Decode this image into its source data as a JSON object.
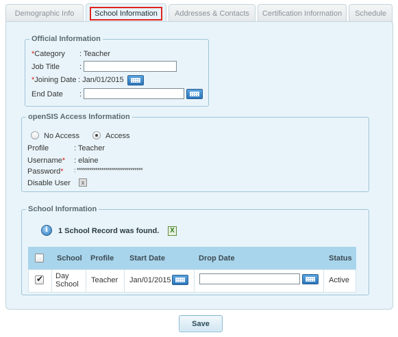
{
  "tabs": [
    {
      "label": "Demographic Info"
    },
    {
      "label": "School Information"
    },
    {
      "label": "Addresses & Contacts"
    },
    {
      "label": "Certification Information"
    },
    {
      "label": "Schedule"
    }
  ],
  "official": {
    "legend": "Official Information",
    "category_label": "Category",
    "category_value": ": Teacher",
    "job_title_label": "Job Title",
    "colon": ":",
    "job_title_value": "",
    "joining_label": "Joining Date",
    "joining_value": ": Jan/01/2015",
    "end_date_label": "End Date",
    "end_date_value": "",
    "required_mark": "*"
  },
  "access": {
    "legend": "openSIS Access Information",
    "no_access_label": "No Access",
    "access_label": "Access",
    "selected": "Access",
    "profile_label": "Profile",
    "profile_value": ": Teacher",
    "username_label": "Username",
    "username_value": ": elaine",
    "password_label": "Password",
    "password_value": ": ********************************",
    "disable_user_label": "Disable User",
    "disable_user_mark": "x",
    "required_mark": "*"
  },
  "school": {
    "legend": "School Information",
    "record_message": "1 School Record was found.",
    "info_icon": "i",
    "excel_icon": "X",
    "columns": [
      "School",
      "Profile",
      "Start Date",
      "Drop Date",
      "Status"
    ],
    "rows": [
      {
        "checked": true,
        "check_mark": "✔",
        "school_line1": "Day",
        "school_line2": "School",
        "profile": "Teacher",
        "start_date": "Jan/01/2015",
        "drop_date": "",
        "status": "Active"
      }
    ]
  },
  "save_label": "Save",
  "colors": {
    "panel_bg": "#e9f4fa",
    "table_header": "#a9d5ec",
    "active_tab_highlight": "#e0231f",
    "required": "#d0201a",
    "calendar_button": "#2b75bd"
  }
}
